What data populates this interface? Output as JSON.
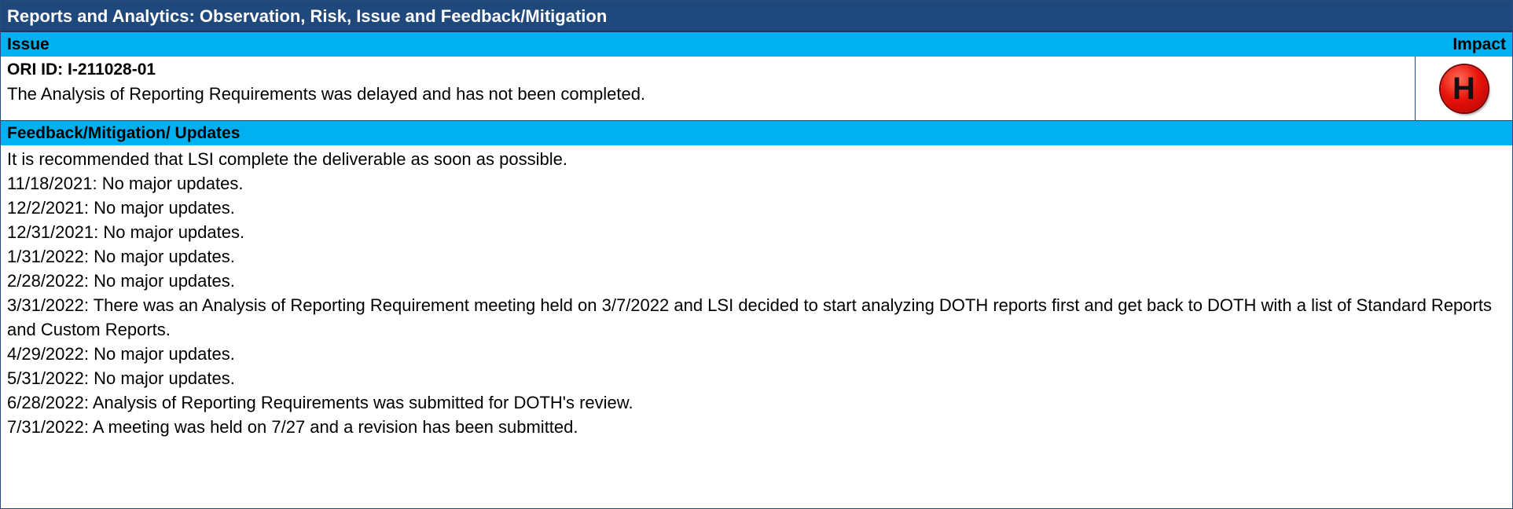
{
  "header": {
    "title": "Reports and Analytics: Observation, Risk, Issue and Feedback/Mitigation"
  },
  "issue_section": {
    "label": "Issue",
    "impact_label": "Impact"
  },
  "issue": {
    "ori_id": "ORI ID: I-211028-01",
    "description": "The Analysis of Reporting Requirements was delayed and has not been completed.",
    "impact_letter": "H",
    "impact_color": "#e8140a"
  },
  "feedback_section": {
    "label": "Feedback/Mitigation/ Updates"
  },
  "feedback": {
    "lines": [
      "It is recommended that LSI complete the deliverable as soon as possible.",
      "11/18/2021: No major updates.",
      "12/2/2021: No major updates.",
      "12/31/2021: No major updates.",
      "1/31/2022: No major updates.",
      "2/28/2022: No major updates.",
      "3/31/2022: There was an Analysis of Reporting Requirement meeting held on 3/7/2022 and LSI decided to start analyzing DOTH reports first and get back to DOTH with a list of Standard Reports and Custom Reports.",
      "4/29/2022: No major updates.",
      "5/31/2022: No major updates.",
      "6/28/2022: Analysis of Reporting Requirements was submitted for DOTH's review.",
      "7/31/2022: A meeting was held on 7/27 and a revision has been submitted."
    ]
  },
  "colors": {
    "title_bar": "#1f497d",
    "section_bar": "#00b0f0",
    "border": "#2a4a7a"
  }
}
